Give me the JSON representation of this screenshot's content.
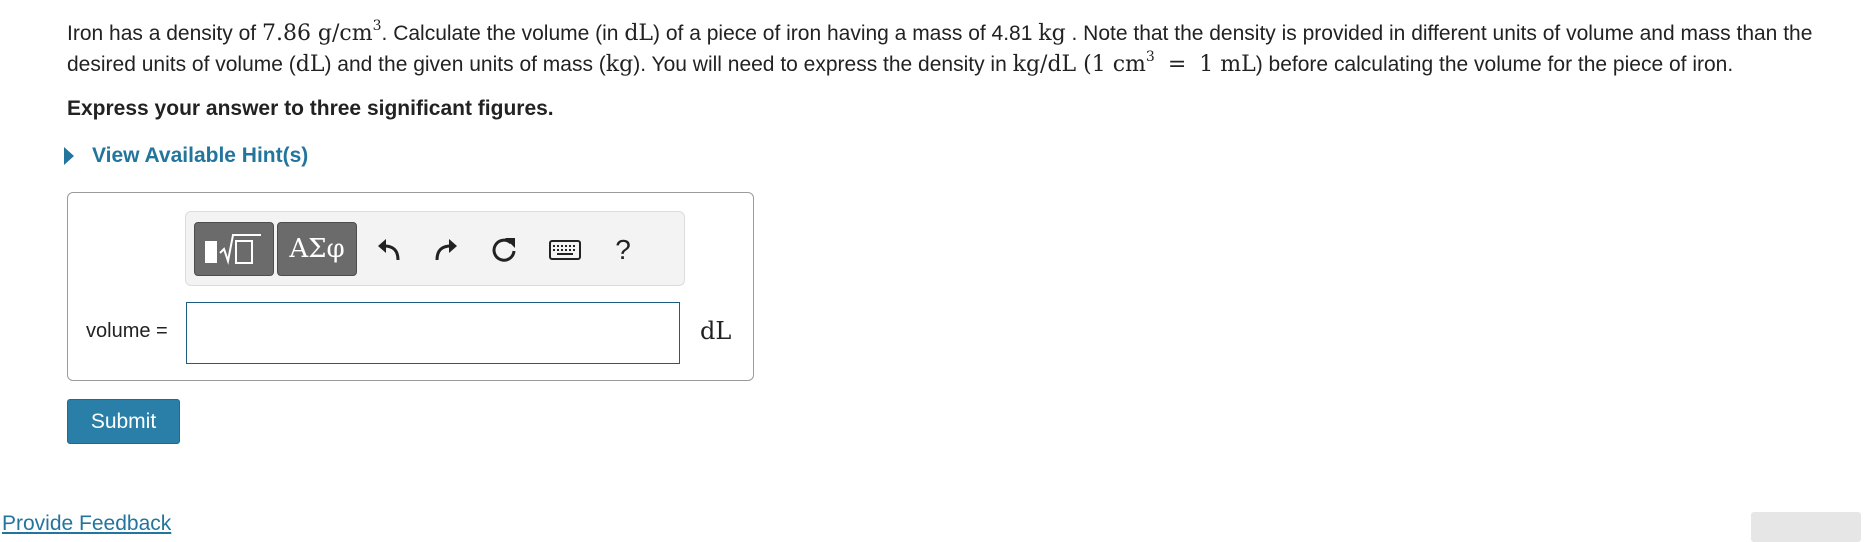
{
  "problem": {
    "p1": "Iron has a density of ",
    "density_value": "7.86 g/cm",
    "density_exp": "3",
    "p2": ". Calculate the volume (in ",
    "unit_dl_1": "dL",
    "p3": ") of a piece of iron having a mass of 4.81 ",
    "unit_kg_1": "kg",
    "p4": " . Note that the density is provided in different units of volume and mass than the desired units of volume (",
    "unit_dl_2": "dL",
    "p5": ") and the given units of mass (",
    "unit_kg_2": "kg",
    "p6": "). You will need to express the density in ",
    "unit_kgdl": "kg/dL",
    "p7": " (",
    "conv_left": "1 cm",
    "conv_exp": "3",
    "conv_eq": " = ",
    "conv_right": "1 mL",
    "p8": ") before calculating the volume for the piece of iron."
  },
  "instruction": "Express your answer to three significant figures.",
  "hint_label": "View Available Hint(s)",
  "toolbar": {
    "greek_label": "ΑΣφ",
    "help_label": "?",
    "icons": [
      "templates-icon",
      "undo-icon",
      "redo-icon",
      "reset-icon",
      "keyboard-icon",
      "help-icon"
    ]
  },
  "answer": {
    "label": "volume =",
    "value": "",
    "unit": "dL"
  },
  "submit_label": "Submit",
  "feedback_label": "Provide Feedback",
  "colors": {
    "link": "#23759e",
    "submit": "#2a7fa8",
    "toolbar_button": "#6b6b6b"
  }
}
